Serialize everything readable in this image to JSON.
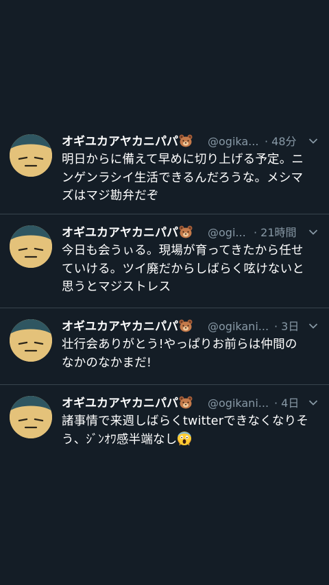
{
  "tweets": [
    {
      "name": "オギユカアヤカニパパ",
      "handle": "@ogika...",
      "time": "· 48分",
      "text_lines": [
        "明日からに備えて早めに切り上げる予定。ニ",
        "ンゲンラシイ生活できるんだろうな。メシマ",
        "ズはマジ勘弁だぞ"
      ]
    },
    {
      "name": "オギユカアヤカニパパ",
      "handle": "@ogi...",
      "time": "· 21時間",
      "text_lines": [
        "今日も会うぃる。現場が育ってきたから任せ",
        "ていける。ツイ廃だからしばらく呟けないと",
        "思うとマジストレス"
      ]
    },
    {
      "name": "オギユカアヤカニパパ",
      "handle": "@ogikani...",
      "time": "· 3日",
      "text_lines": [
        "壮行会ありがとう!やっぱりお前らは仲間の",
        "なかのなかまだ!"
      ]
    },
    {
      "name": "オギユカアヤカニパパ",
      "handle": "@ogikani...",
      "time": "· 4日",
      "text_lines": [
        "諸事情で来週しばらくtwitterできなくなりそ",
        "う、ｼﾞﾝｵﾜ感半端なし"
      ]
    }
  ],
  "icons": {
    "name_suffix": "bear-face-icon",
    "scream": "face-screaming-icon",
    "menu": "chevron-down-icon",
    "avatar": "sleepy-face-avatar"
  },
  "colors": {
    "background": "#141d26",
    "divider": "#38444d",
    "secondary_text": "#8899a6"
  }
}
